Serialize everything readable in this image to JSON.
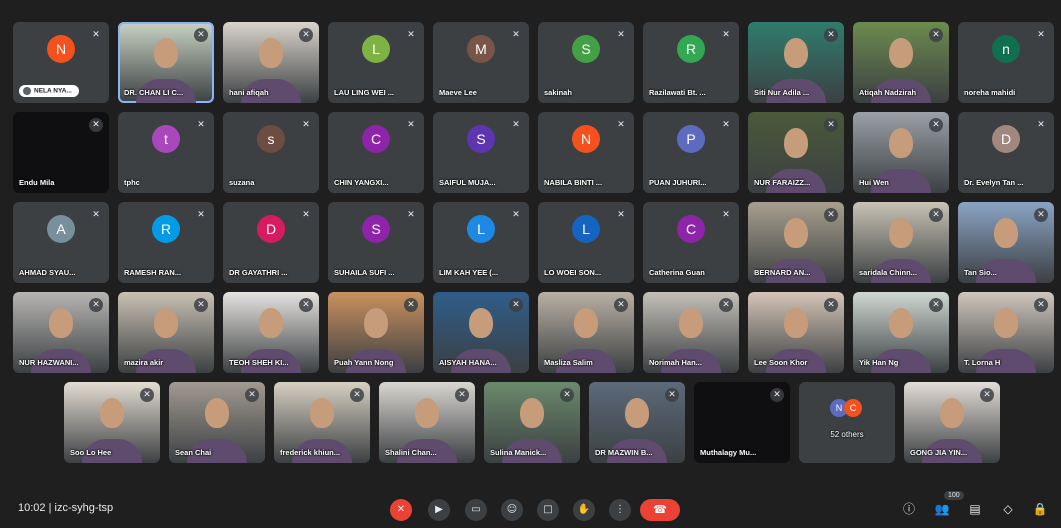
{
  "participants": [
    {
      "name": "NELA NYA...",
      "type": "letter",
      "letter": "N",
      "color": "#f4511e",
      "raised_hand": true
    },
    {
      "name": "DR. CHAN LI C...",
      "type": "video",
      "tone": "#c9d3c4",
      "active": true
    },
    {
      "name": "hani afiqah",
      "type": "video",
      "tone": "#d9d4cc"
    },
    {
      "name": "LAU LING WEI ...",
      "type": "letter",
      "letter": "L",
      "color": "#7cb342"
    },
    {
      "name": "Maeve Lee",
      "type": "letter",
      "letter": "M",
      "color": "#795548"
    },
    {
      "name": "sakinah",
      "type": "letter",
      "letter": "S",
      "color": "#43a047"
    },
    {
      "name": "Razilawati Bt. ...",
      "type": "letter",
      "letter": "R",
      "color": "#33a852"
    },
    {
      "name": "Siti Nur Adila ...",
      "type": "photo",
      "tone": "#2f7d6b"
    },
    {
      "name": "Atiqah Nadzirah",
      "type": "photo",
      "tone": "#6d8b4f"
    },
    {
      "name": "noreha mahidi",
      "type": "letter",
      "letter": "n",
      "color": "#0f6f4f"
    },
    {
      "name": "Endu Mila",
      "type": "dark"
    },
    {
      "name": "tphc",
      "type": "letter",
      "letter": "t",
      "color": "#ab47bc"
    },
    {
      "name": "suzana",
      "type": "letter",
      "letter": "s",
      "color": "#6d4c41"
    },
    {
      "name": "CHIN YANGXI...",
      "type": "letter",
      "letter": "C",
      "color": "#8e24aa"
    },
    {
      "name": "SAIFUL MUJA...",
      "type": "letter",
      "letter": "S",
      "color": "#5e35b1"
    },
    {
      "name": "NABILA BINTI ...",
      "type": "letter",
      "letter": "N",
      "color": "#f4511e"
    },
    {
      "name": "PUAN JUHURI...",
      "type": "letter",
      "letter": "P",
      "color": "#5c6bc0"
    },
    {
      "name": "NUR FARAIZZ...",
      "type": "photo",
      "tone": "#4a5a3a"
    },
    {
      "name": "Hui Wen",
      "type": "video",
      "tone": "#9aa0a6"
    },
    {
      "name": "Dr. Evelyn Tan ...",
      "type": "letter",
      "letter": "D",
      "color": "#a1887f"
    },
    {
      "name": "AHMAD SYAU...",
      "type": "letter",
      "letter": "A",
      "color": "#78909c"
    },
    {
      "name": "RAMESH RAN...",
      "type": "letter",
      "letter": "R",
      "color": "#039be5"
    },
    {
      "name": "DR GAYATHRI ...",
      "type": "letter",
      "letter": "D",
      "color": "#d81b60"
    },
    {
      "name": "SUHAILA SUFI ...",
      "type": "letter",
      "letter": "S",
      "color": "#8e24aa"
    },
    {
      "name": "LIM KAH YEE (...",
      "type": "letter",
      "letter": "L",
      "color": "#1e88e5"
    },
    {
      "name": "LO WOEI SON...",
      "type": "letter",
      "letter": "L",
      "color": "#1565c0"
    },
    {
      "name": "Catherina Guan",
      "type": "letter",
      "letter": "C",
      "color": "#8e24aa"
    },
    {
      "name": "BERNARD AN...",
      "type": "video",
      "tone": "#a89f8e"
    },
    {
      "name": "saridala Chinn...",
      "type": "video",
      "tone": "#c7c2b4"
    },
    {
      "name": "Tan Sio...",
      "type": "video",
      "tone": "#8aa4c4"
    },
    {
      "name": "NUR HAZWANI...",
      "type": "video",
      "tone": "#b7b5b2"
    },
    {
      "name": "mazira akir",
      "type": "video",
      "tone": "#c9c1b3"
    },
    {
      "name": "TEOH SHEH KI...",
      "type": "video",
      "tone": "#e6e3e0"
    },
    {
      "name": "Puah Yann Nong",
      "type": "video",
      "tone": "#c9915e"
    },
    {
      "name": "AISYAH HANA...",
      "type": "video",
      "tone": "#2f5d8a"
    },
    {
      "name": "Masliza Salim",
      "type": "video",
      "tone": "#b9b0a4"
    },
    {
      "name": "Norimah Han...",
      "type": "video",
      "tone": "#c4c0b8"
    },
    {
      "name": "Lee Soon Khor",
      "type": "video",
      "tone": "#d3c4b6"
    },
    {
      "name": "Yik Han Ng",
      "type": "video",
      "tone": "#cfd8d2"
    },
    {
      "name": "T. Lorna H",
      "type": "video",
      "tone": "#cfc6bd"
    },
    {
      "name": "Soo Lo Hee",
      "type": "video",
      "tone": "#e3dcd1"
    },
    {
      "name": "Sean Chai",
      "type": "video",
      "tone": "#a19a90"
    },
    {
      "name": "frederick khiun...",
      "type": "video",
      "tone": "#d6d0c2"
    },
    {
      "name": "Shalini Chan...",
      "type": "video",
      "tone": "#d9d6d1"
    },
    {
      "name": "Sulina Manick...",
      "type": "video",
      "tone": "#6b8a6c"
    },
    {
      "name": "DR MAZWIN B...",
      "type": "video",
      "tone": "#5c6a7a"
    },
    {
      "name": "Muthalagy Mu...",
      "type": "dark"
    },
    {
      "name": "52 others",
      "type": "others"
    },
    {
      "name": "GONG JIA YIN...",
      "type": "video",
      "tone": "#e2ddd6"
    }
  ],
  "others": {
    "letter1": "N",
    "letter2": "C",
    "color1": "#5c6bc0",
    "color2": "#f4511e"
  },
  "bottom_bar": {
    "meeting_info": "10:02  |  izc-syhg-tsp",
    "people_count": "100"
  }
}
